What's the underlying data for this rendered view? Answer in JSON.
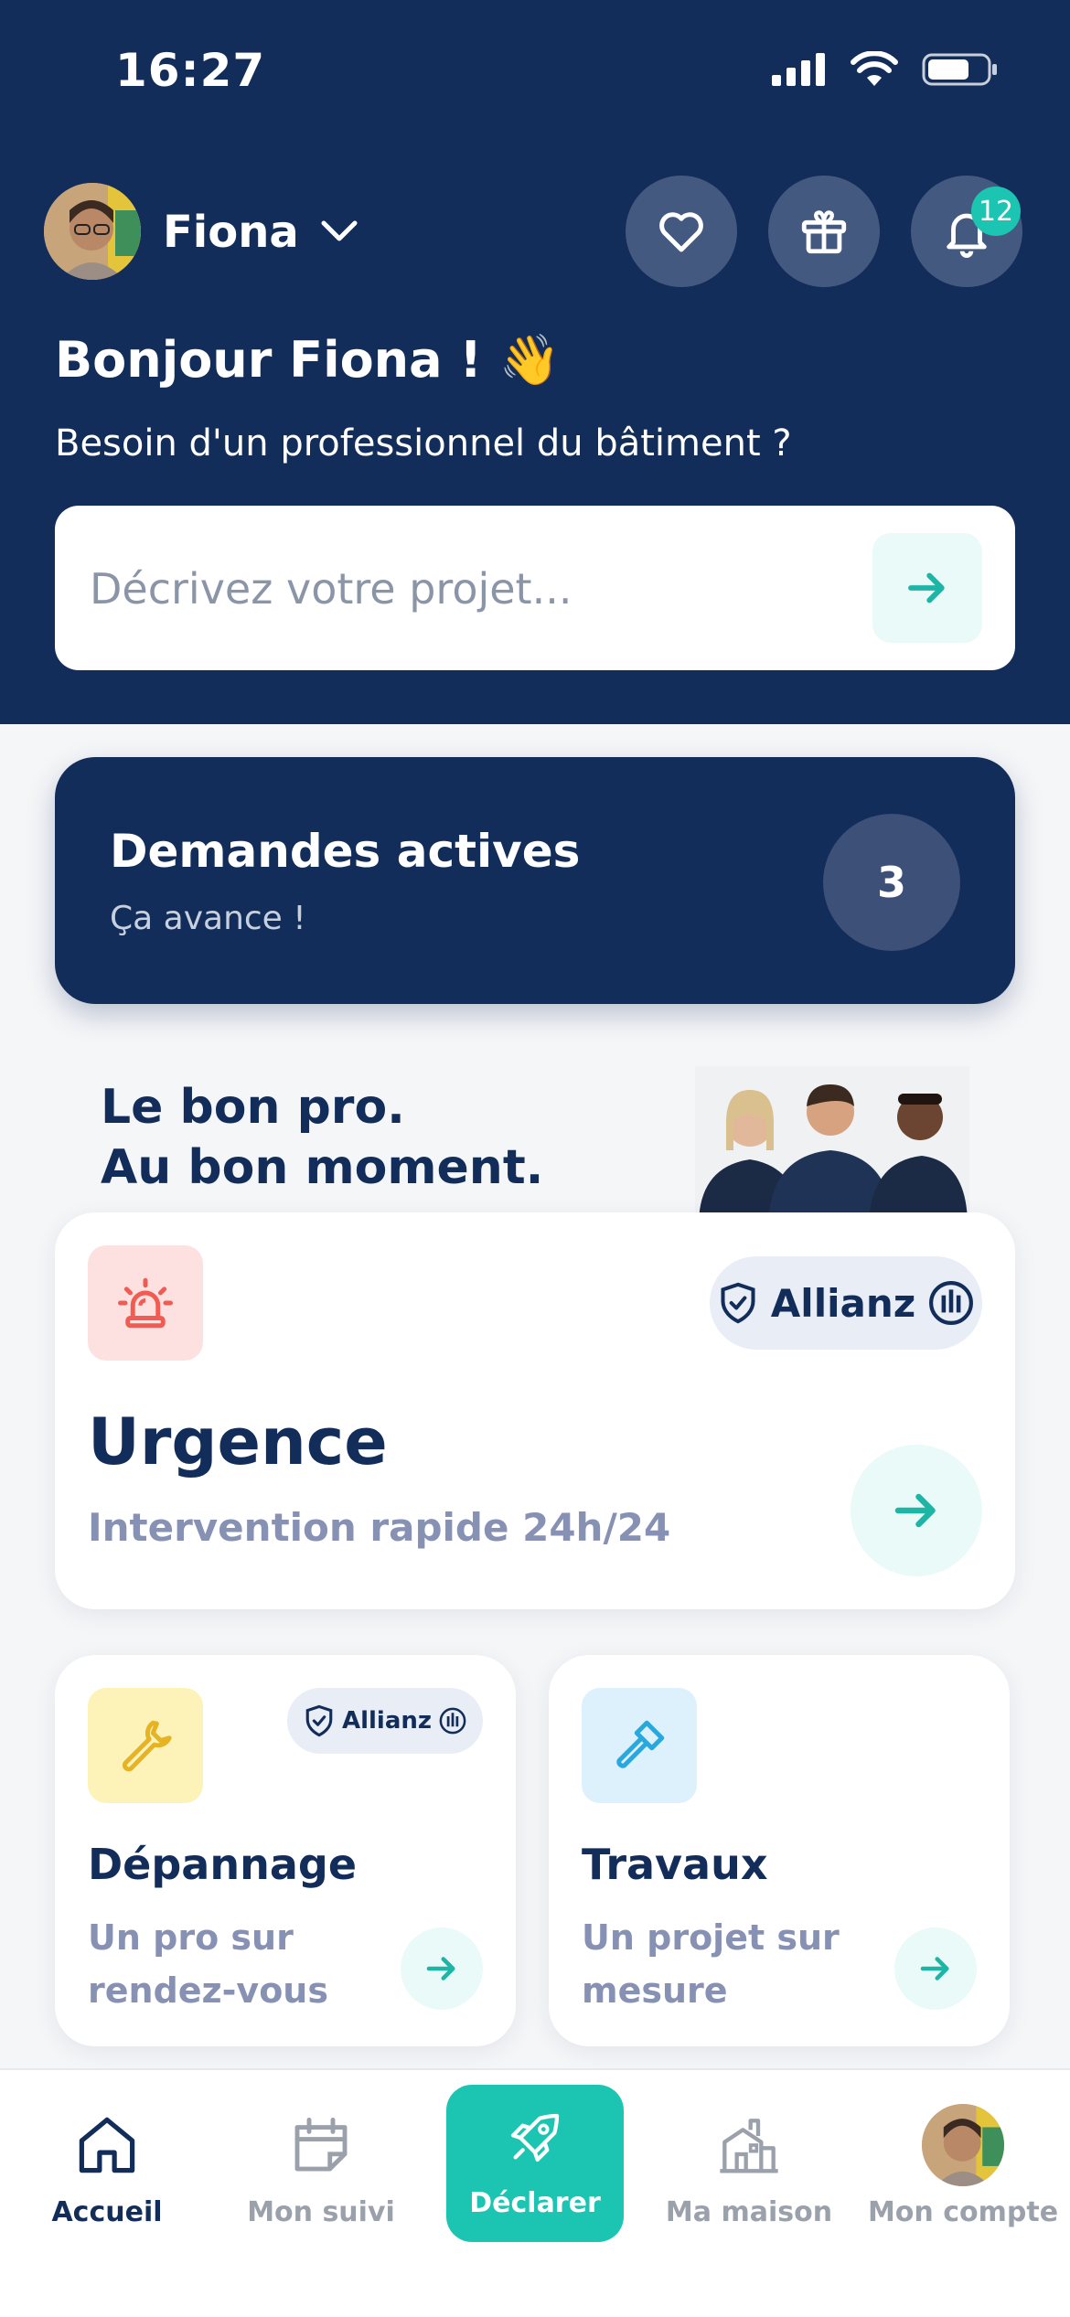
{
  "status_bar": {
    "time": "16:27"
  },
  "profile": {
    "name": "Fiona",
    "notification_count": "12"
  },
  "greeting": {
    "title": "Bonjour Fiona ! 👋",
    "subtitle": "Besoin d'un professionnel du bâtiment ?"
  },
  "search": {
    "placeholder": "Décrivez votre projet..."
  },
  "active_requests": {
    "title": "Demandes actives",
    "subtitle": "Ça avance !",
    "count": "3"
  },
  "promo": {
    "line1": "Le bon pro.",
    "line2": "Au bon moment."
  },
  "urgence": {
    "title": "Urgence",
    "subtitle": "Intervention rapide 24h/24",
    "partner": "Allianz"
  },
  "depannage": {
    "title": "Dépannage",
    "subtitle_line1": "Un pro sur",
    "subtitle_line2": "rendez-vous",
    "partner": "Allianz"
  },
  "travaux": {
    "title": "Travaux",
    "subtitle_line1": "Un projet sur",
    "subtitle_line2": "mesure"
  },
  "tabbar": {
    "home": "Accueil",
    "tracking": "Mon suivi",
    "declare": "Déclarer",
    "house": "Ma maison",
    "account": "Mon compte"
  },
  "colors": {
    "navy": "#122d5a",
    "accent": "#1cc4b2",
    "background": "#f5f6f8"
  },
  "icons": [
    "heart-icon",
    "gift-icon",
    "bell-icon",
    "arrow-right-icon",
    "siren-icon",
    "wrench-icon",
    "hammer-icon",
    "home-icon",
    "calendar-icon",
    "rocket-icon",
    "house-icon"
  ]
}
